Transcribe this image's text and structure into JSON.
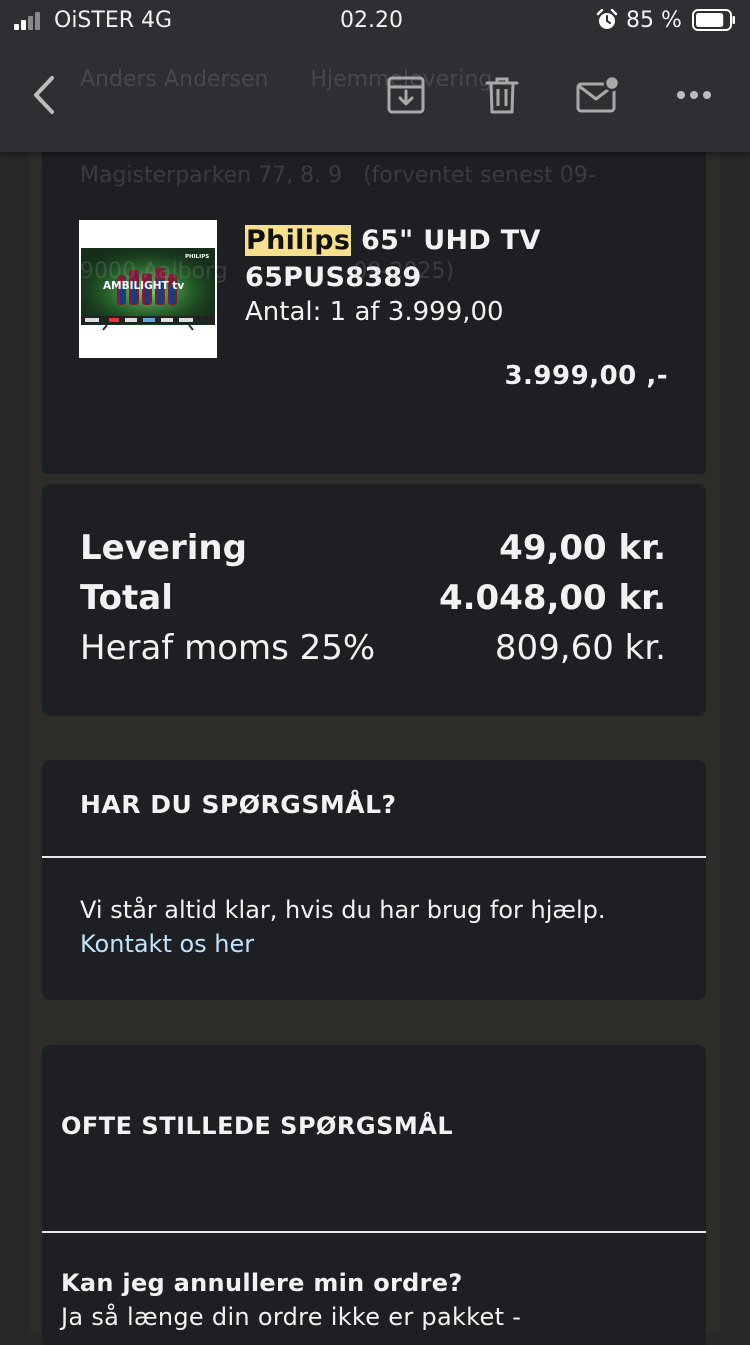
{
  "status_bar": {
    "carrier": "OiSTER  4G",
    "time": "02.20",
    "battery_percent": "85 %",
    "battery_level": 0.85,
    "icons": [
      "signal-icon",
      "alarm-icon",
      "battery-icon"
    ]
  },
  "header": {
    "ghost_lines": [
      "Anders Andersen      Hjemmelevering",
      "Magisterparken 77, 8. 9   (forventet senest 09-",
      "9000 Aalborg                  09-2025)"
    ],
    "buttons": [
      "back-icon",
      "archive-icon",
      "trash-icon",
      "mail-unread-icon",
      "more-icon"
    ]
  },
  "product": {
    "brand": "Philips",
    "name_rest": " 65\" UHD TV",
    "model": "65PUS8389",
    "quantity_line": "Antal: 1 af 3.999,00",
    "line_total": "3.999,00 ,-",
    "image": {
      "brand_text": "PHILIPS",
      "badge_text": "AMBILIGHT tv"
    }
  },
  "totals": {
    "rows": [
      {
        "label": "Levering",
        "value": "49,00 kr."
      },
      {
        "label": "Total",
        "value": "4.048,00 kr."
      },
      {
        "label": "Heraf moms 25%",
        "value": "809,60 kr."
      }
    ]
  },
  "questions": {
    "title": "HAR DU SPØRGSMÅL?",
    "body": "Vi står altid klar, hvis du har brug for hjælp.",
    "link": "Kontakt os her"
  },
  "faq": {
    "title": "OFTE STILLEDE SPØRGSMÅL",
    "question": "Kan jeg annullere min ordre?",
    "answer": "Ja så længe din ordre ikke er pakket -"
  },
  "colors": {
    "page_bg": "#28282b",
    "card_bg": "#1e1f23",
    "highlight": "#f6e08f",
    "link": "#bfe3ff"
  }
}
